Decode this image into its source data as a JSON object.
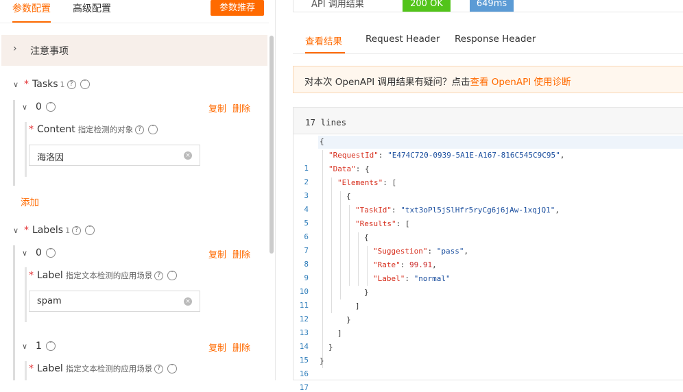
{
  "left": {
    "tabs": [
      {
        "label": "参数配置",
        "active": true
      },
      {
        "label": "高级配置",
        "active": false
      }
    ],
    "recommend_button": "参数推荐",
    "notice_label": "注意事项",
    "tasks": {
      "label": "Tasks",
      "count": "1",
      "item_index": "0",
      "copy": "复制",
      "delete": "删除",
      "field_label": "Content",
      "field_hint": "指定检测的对象",
      "field_value": "海洛因",
      "add": "添加"
    },
    "labels": {
      "label": "Labels",
      "count": "1",
      "items": [
        {
          "index": "0",
          "copy": "复制",
          "delete": "删除",
          "field_label": "Label",
          "field_hint": "指定文本检测的应用场景",
          "field_value": "spam"
        },
        {
          "index": "1",
          "copy": "复制",
          "delete": "删除",
          "field_label": "Label",
          "field_hint": "指定文本检测的应用场景"
        }
      ]
    }
  },
  "right": {
    "status_label": "API 调用结果",
    "status_code": "200 OK",
    "latency": "649ms",
    "colors": {
      "ok": "#52c41a",
      "latency": "#5b9bd5",
      "accent": "#ff6a00"
    },
    "tabs": [
      {
        "label": "查看结果",
        "active": true
      },
      {
        "label": "Request Header",
        "active": false
      },
      {
        "label": "Response Header",
        "active": false
      }
    ],
    "diagnosis_prefix": "对本次 OpenAPI 调用结果有疑问？点击",
    "diagnosis_link": "查看 OpenAPI 使用诊断",
    "code_header": "17 lines",
    "line_numbers": [
      "1",
      "2",
      "3",
      "4",
      "5",
      "6",
      "7",
      "8",
      "9",
      "10",
      "11",
      "12",
      "13",
      "14",
      "15",
      "16",
      "17"
    ],
    "code": {
      "l1": "{",
      "k2": "\"RequestId\"",
      "v2": "\"E474C720-0939-5A1E-A167-816C545C9C95\"",
      "k3": "\"Data\"",
      "p3": ": {",
      "k4": "\"Elements\"",
      "p4": ": [",
      "l5": "{",
      "k6": "\"TaskId\"",
      "v6": "\"txt3oPl5jSlHfr5ryCg6j6jAw-1xqjQ1\"",
      "k7": "\"Results\"",
      "p7": ": [",
      "l8": "{",
      "k9": "\"Suggestion\"",
      "v9": "\"pass\"",
      "k10": "\"Rate\"",
      "v10": "99.91",
      "k11": "\"Label\"",
      "v11": "\"normal\"",
      "l12": "}",
      "l13": "]",
      "l14": "}",
      "l15": "]",
      "l16": "}",
      "l17": "}"
    }
  }
}
